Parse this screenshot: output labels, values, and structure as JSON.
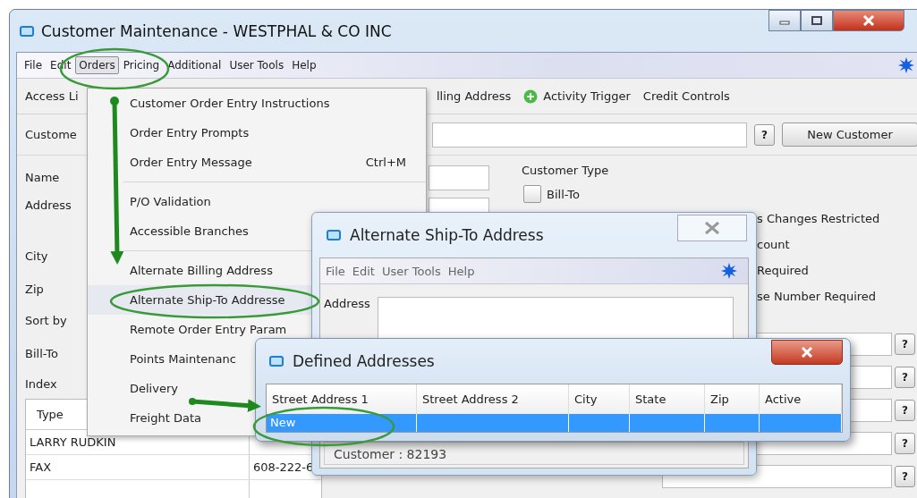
{
  "window": {
    "title": "Customer Maintenance - WESTPHAL & CO INC"
  },
  "menu": [
    {
      "label": "File",
      "selected": false
    },
    {
      "label": "Edit",
      "selected": false
    },
    {
      "label": "Orders",
      "selected": true
    },
    {
      "label": "Pricing",
      "selected": false
    },
    {
      "label": "Additional",
      "selected": false
    },
    {
      "label": "User Tools",
      "selected": false
    },
    {
      "label": "Help",
      "selected": false
    }
  ],
  "tabs": [
    {
      "label": "Access Li"
    },
    {
      "label": "lling Address"
    },
    {
      "label": "Activity Trigger",
      "kind": "action"
    },
    {
      "label": "Credit Controls"
    }
  ],
  "customer_row": {
    "label": "Custome",
    "lookup": "?",
    "button": "New Customer"
  },
  "form_labels": [
    "Name",
    "Address",
    "City",
    "Zip",
    "Sort by",
    "Bill-To",
    "Index"
  ],
  "customer_type": {
    "title": "Customer Type",
    "options": [
      {
        "label": "Bill-To",
        "checked": false
      }
    ],
    "notes": [
      "s Changes Restricted",
      "count",
      "Required",
      "se Number Required"
    ]
  },
  "lookups": [
    "?",
    "?",
    "?",
    "?",
    "?"
  ],
  "contacts": {
    "columns": [
      "Type"
    ],
    "rows": [
      {
        "type": "LARRY RUDKIN"
      },
      {
        "type": "FAX",
        "number": "608-222-6"
      }
    ]
  },
  "orders_menu": {
    "groups": [
      [
        {
          "label": "Customer Order Entry Instructions",
          "selected": false
        },
        {
          "label": "Order Entry Prompts",
          "selected": false
        },
        {
          "label": "Order Entry Message",
          "shortcut": "Ctrl+M",
          "selected": false
        }
      ],
      [
        {
          "label": "P/O Validation",
          "selected": false
        },
        {
          "label": "Accessible Branches",
          "selected": false
        }
      ],
      [
        {
          "label": "Alternate Billing Address",
          "selected": false
        },
        {
          "label": "Alternate Ship-To Addresse",
          "selected": true
        },
        {
          "label": "Remote Order Entry Param",
          "selected": false
        },
        {
          "label": "Points Maintenanc",
          "selected": false
        },
        {
          "label": "Delivery",
          "selected": false
        },
        {
          "label": "Freight Data",
          "selected": false
        }
      ]
    ]
  },
  "ship_to_dialog": {
    "title": "Alternate Ship-To Address",
    "menu": [
      "File",
      "Edit",
      "User Tools",
      "Help"
    ],
    "address_label": "Address",
    "footer": "Customer : 82193"
  },
  "defined_dialog": {
    "title": "Defined Addresses",
    "columns": [
      "Street Address 1",
      "Street Address 2",
      "City",
      "State",
      "Zip",
      "Active"
    ],
    "rows": [
      {
        "cells": [
          "New"
        ],
        "selected": true
      }
    ]
  }
}
